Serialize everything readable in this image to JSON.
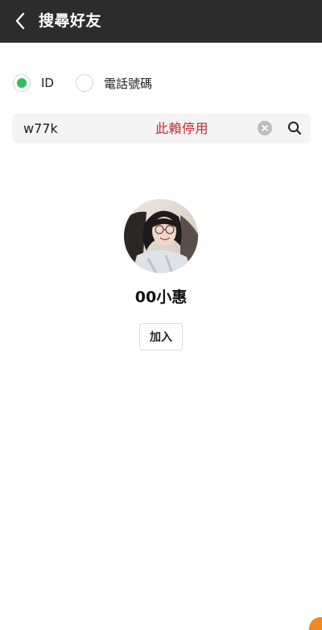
{
  "header": {
    "title": "搜尋好友",
    "back_icon": "chevron-left-icon",
    "background": "#2c2c2c"
  },
  "search_type": {
    "options": [
      {
        "label": "ID",
        "selected": true
      },
      {
        "label": "電話號碼",
        "selected": false
      }
    ],
    "accent_color": "#2fbf5e"
  },
  "search": {
    "value": "w77k",
    "notice": "此賴停用",
    "notice_color": "#c9232a",
    "clear_icon": "clear-circle-icon",
    "search_icon": "search-icon"
  },
  "result": {
    "name": "00小惠",
    "add_label": "加入"
  }
}
